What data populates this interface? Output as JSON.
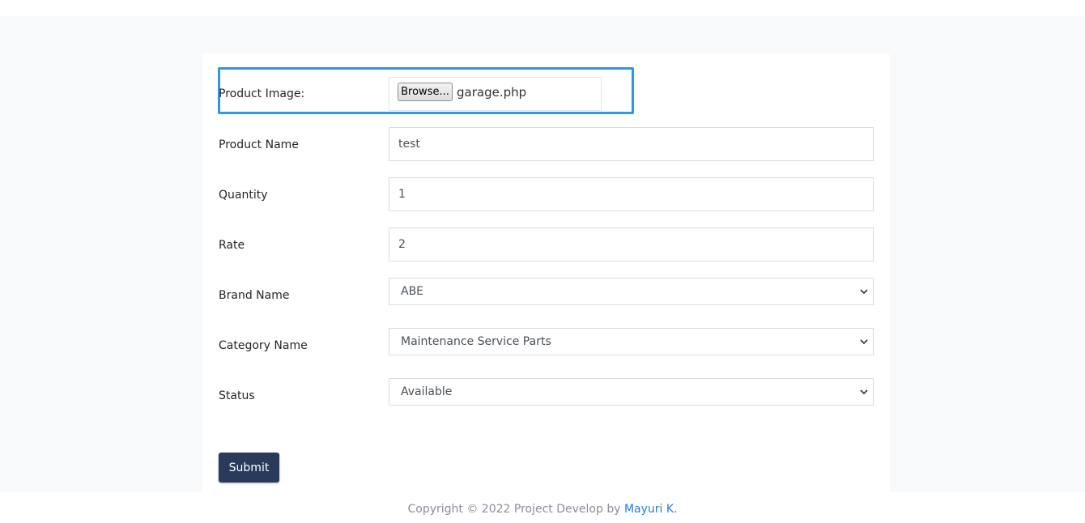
{
  "form": {
    "product_image": {
      "label": "Product Image:",
      "browse_label": "Browse...",
      "file_name": "garage.php"
    },
    "product_name": {
      "label": "Product Name",
      "value": "test"
    },
    "quantity": {
      "label": "Quantity",
      "value": "1"
    },
    "rate": {
      "label": "Rate",
      "value": "2"
    },
    "brand_name": {
      "label": "Brand Name",
      "selected": "ABE"
    },
    "category_name": {
      "label": "Category Name",
      "selected": "Maintenance Service Parts"
    },
    "status": {
      "label": "Status",
      "selected": "Available"
    },
    "submit_label": "Submit"
  },
  "footer": {
    "text": "Copyright © 2022 Project Develop by ",
    "author": "Mayuri K."
  },
  "colors": {
    "highlight_border": "#2b98e8",
    "submit_bg": "#2a3a5a",
    "link": "#2b7bd6"
  },
  "icons": [
    "chevron-down-icon"
  ]
}
